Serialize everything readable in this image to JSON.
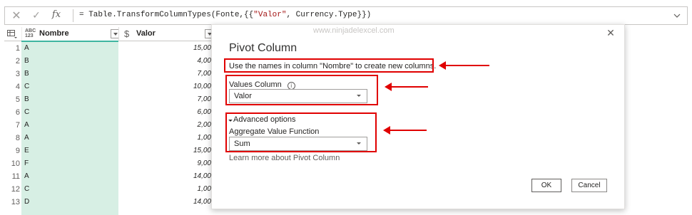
{
  "formula_bar": {
    "cancel_icon": "close-icon",
    "commit_icon": "check-icon",
    "fx_label": "fx",
    "formula_pre": "= Table.TransformColumnTypes(Fonte,{{",
    "formula_str": "\"Valor\"",
    "formula_post": ", Currency.Type}})"
  },
  "grid": {
    "columns": [
      {
        "type_top": "ABC",
        "type_bottom": "123",
        "label": "Nombre"
      },
      {
        "type_symbol": "$",
        "label": "Valor"
      }
    ],
    "rows": [
      {
        "n": "1",
        "nombre": "A",
        "valor": "15,00"
      },
      {
        "n": "2",
        "nombre": "B",
        "valor": "4,00"
      },
      {
        "n": "3",
        "nombre": "B",
        "valor": "7,00"
      },
      {
        "n": "4",
        "nombre": "C",
        "valor": "10,00"
      },
      {
        "n": "5",
        "nombre": "B",
        "valor": "7,00"
      },
      {
        "n": "6",
        "nombre": "C",
        "valor": "6,00"
      },
      {
        "n": "7",
        "nombre": "A",
        "valor": "2,00"
      },
      {
        "n": "8",
        "nombre": "A",
        "valor": "1,00"
      },
      {
        "n": "9",
        "nombre": "E",
        "valor": "15,00"
      },
      {
        "n": "10",
        "nombre": "F",
        "valor": "9,00"
      },
      {
        "n": "11",
        "nombre": "A",
        "valor": "14,00"
      },
      {
        "n": "12",
        "nombre": "C",
        "valor": "1,00"
      },
      {
        "n": "13",
        "nombre": "D",
        "valor": "14,00"
      }
    ]
  },
  "dialog": {
    "watermark": "www.ninjadelexcel.com",
    "title": "Pivot Column",
    "description": "Use the names in column \"Nombre\" to create new columns.",
    "values_column_label": "Values Column",
    "info_icon": "i",
    "values_column_value": "Valor",
    "advanced_label": "Advanced options",
    "aggregate_label": "Aggregate Value Function",
    "aggregate_value": "Sum",
    "learn_more": "Learn more about Pivot Column",
    "ok": "OK",
    "cancel": "Cancel",
    "close_glyph": "✕"
  },
  "colors": {
    "annotation_red": "#e00000",
    "selected_column_bg": "#d7efe4",
    "column_accent": "#3fb5a0"
  }
}
